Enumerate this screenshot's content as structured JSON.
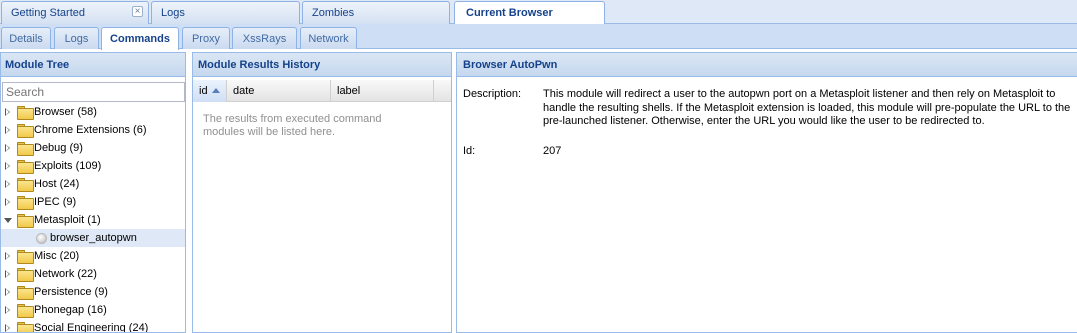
{
  "top_tabs": [
    {
      "label": "Getting Started",
      "closable": true
    },
    {
      "label": "Logs",
      "closable": false
    },
    {
      "label": "Zombies",
      "closable": false
    },
    {
      "label": "Current Browser",
      "closable": false,
      "active": true
    }
  ],
  "close_glyph": "×",
  "sub_tabs": [
    {
      "label": "Details"
    },
    {
      "label": "Logs"
    },
    {
      "label": "Commands",
      "active": true
    },
    {
      "label": "Proxy"
    },
    {
      "label": "XssRays"
    },
    {
      "label": "Network"
    }
  ],
  "module_tree": {
    "title": "Module Tree",
    "search_placeholder": "Search",
    "items": [
      {
        "label": "Browser (58)"
      },
      {
        "label": "Chrome Extensions (6)"
      },
      {
        "label": "Debug (9)"
      },
      {
        "label": "Exploits (109)"
      },
      {
        "label": "Host (24)"
      },
      {
        "label": "IPEC (9)"
      },
      {
        "label": "Metasploit (1)",
        "expanded": true
      },
      {
        "label": "browser_autopwn",
        "leaf": true,
        "selected": true
      },
      {
        "label": "Misc (20)"
      },
      {
        "label": "Network (22)"
      },
      {
        "label": "Persistence (9)"
      },
      {
        "label": "Phonegap (16)"
      },
      {
        "label": "Social Engineering (24)"
      }
    ]
  },
  "results": {
    "title": "Module Results History",
    "columns": [
      "id",
      "date",
      "label"
    ],
    "sorted_column": "id",
    "sort_direction": "ascending",
    "empty_text": "The results from executed command modules will be listed here."
  },
  "details": {
    "title": "Browser AutoPwn",
    "description_label": "Description:",
    "description": "This module will redirect a user to the autopwn port on a Metasploit listener and then rely on Metasploit to handle the resulting shells. If the Metasploit extension is loaded, this module will pre-populate the URL to the pre-launched listener. Otherwise, enter the URL you would like the user to be redirected to.",
    "id_label": "Id:",
    "id": "207"
  }
}
